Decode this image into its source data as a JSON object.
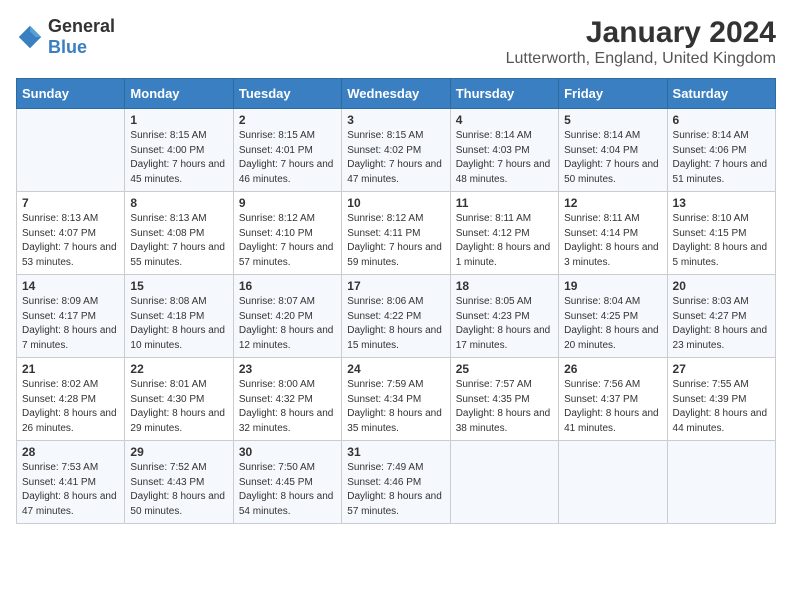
{
  "header": {
    "logo_general": "General",
    "logo_blue": "Blue",
    "month_title": "January 2024",
    "location": "Lutterworth, England, United Kingdom"
  },
  "days_of_week": [
    "Sunday",
    "Monday",
    "Tuesday",
    "Wednesday",
    "Thursday",
    "Friday",
    "Saturday"
  ],
  "weeks": [
    [
      {
        "day": "",
        "content": ""
      },
      {
        "day": "1",
        "content": "Sunrise: 8:15 AM\nSunset: 4:00 PM\nDaylight: 7 hours\nand 45 minutes."
      },
      {
        "day": "2",
        "content": "Sunrise: 8:15 AM\nSunset: 4:01 PM\nDaylight: 7 hours\nand 46 minutes."
      },
      {
        "day": "3",
        "content": "Sunrise: 8:15 AM\nSunset: 4:02 PM\nDaylight: 7 hours\nand 47 minutes."
      },
      {
        "day": "4",
        "content": "Sunrise: 8:14 AM\nSunset: 4:03 PM\nDaylight: 7 hours\nand 48 minutes."
      },
      {
        "day": "5",
        "content": "Sunrise: 8:14 AM\nSunset: 4:04 PM\nDaylight: 7 hours\nand 50 minutes."
      },
      {
        "day": "6",
        "content": "Sunrise: 8:14 AM\nSunset: 4:06 PM\nDaylight: 7 hours\nand 51 minutes."
      }
    ],
    [
      {
        "day": "7",
        "content": "Sunrise: 8:13 AM\nSunset: 4:07 PM\nDaylight: 7 hours\nand 53 minutes."
      },
      {
        "day": "8",
        "content": "Sunrise: 8:13 AM\nSunset: 4:08 PM\nDaylight: 7 hours\nand 55 minutes."
      },
      {
        "day": "9",
        "content": "Sunrise: 8:12 AM\nSunset: 4:10 PM\nDaylight: 7 hours\nand 57 minutes."
      },
      {
        "day": "10",
        "content": "Sunrise: 8:12 AM\nSunset: 4:11 PM\nDaylight: 7 hours\nand 59 minutes."
      },
      {
        "day": "11",
        "content": "Sunrise: 8:11 AM\nSunset: 4:12 PM\nDaylight: 8 hours\nand 1 minute."
      },
      {
        "day": "12",
        "content": "Sunrise: 8:11 AM\nSunset: 4:14 PM\nDaylight: 8 hours\nand 3 minutes."
      },
      {
        "day": "13",
        "content": "Sunrise: 8:10 AM\nSunset: 4:15 PM\nDaylight: 8 hours\nand 5 minutes."
      }
    ],
    [
      {
        "day": "14",
        "content": "Sunrise: 8:09 AM\nSunset: 4:17 PM\nDaylight: 8 hours\nand 7 minutes."
      },
      {
        "day": "15",
        "content": "Sunrise: 8:08 AM\nSunset: 4:18 PM\nDaylight: 8 hours\nand 10 minutes."
      },
      {
        "day": "16",
        "content": "Sunrise: 8:07 AM\nSunset: 4:20 PM\nDaylight: 8 hours\nand 12 minutes."
      },
      {
        "day": "17",
        "content": "Sunrise: 8:06 AM\nSunset: 4:22 PM\nDaylight: 8 hours\nand 15 minutes."
      },
      {
        "day": "18",
        "content": "Sunrise: 8:05 AM\nSunset: 4:23 PM\nDaylight: 8 hours\nand 17 minutes."
      },
      {
        "day": "19",
        "content": "Sunrise: 8:04 AM\nSunset: 4:25 PM\nDaylight: 8 hours\nand 20 minutes."
      },
      {
        "day": "20",
        "content": "Sunrise: 8:03 AM\nSunset: 4:27 PM\nDaylight: 8 hours\nand 23 minutes."
      }
    ],
    [
      {
        "day": "21",
        "content": "Sunrise: 8:02 AM\nSunset: 4:28 PM\nDaylight: 8 hours\nand 26 minutes."
      },
      {
        "day": "22",
        "content": "Sunrise: 8:01 AM\nSunset: 4:30 PM\nDaylight: 8 hours\nand 29 minutes."
      },
      {
        "day": "23",
        "content": "Sunrise: 8:00 AM\nSunset: 4:32 PM\nDaylight: 8 hours\nand 32 minutes."
      },
      {
        "day": "24",
        "content": "Sunrise: 7:59 AM\nSunset: 4:34 PM\nDaylight: 8 hours\nand 35 minutes."
      },
      {
        "day": "25",
        "content": "Sunrise: 7:57 AM\nSunset: 4:35 PM\nDaylight: 8 hours\nand 38 minutes."
      },
      {
        "day": "26",
        "content": "Sunrise: 7:56 AM\nSunset: 4:37 PM\nDaylight: 8 hours\nand 41 minutes."
      },
      {
        "day": "27",
        "content": "Sunrise: 7:55 AM\nSunset: 4:39 PM\nDaylight: 8 hours\nand 44 minutes."
      }
    ],
    [
      {
        "day": "28",
        "content": "Sunrise: 7:53 AM\nSunset: 4:41 PM\nDaylight: 8 hours\nand 47 minutes."
      },
      {
        "day": "29",
        "content": "Sunrise: 7:52 AM\nSunset: 4:43 PM\nDaylight: 8 hours\nand 50 minutes."
      },
      {
        "day": "30",
        "content": "Sunrise: 7:50 AM\nSunset: 4:45 PM\nDaylight: 8 hours\nand 54 minutes."
      },
      {
        "day": "31",
        "content": "Sunrise: 7:49 AM\nSunset: 4:46 PM\nDaylight: 8 hours\nand 57 minutes."
      },
      {
        "day": "",
        "content": ""
      },
      {
        "day": "",
        "content": ""
      },
      {
        "day": "",
        "content": ""
      }
    ]
  ]
}
